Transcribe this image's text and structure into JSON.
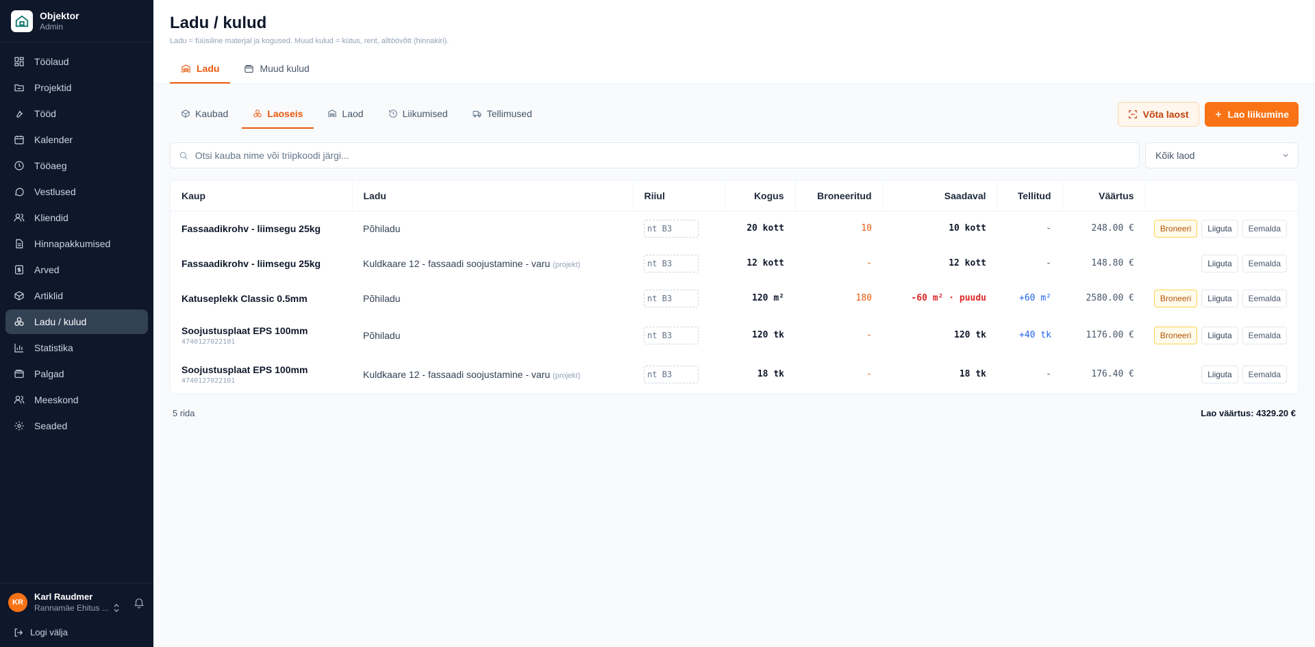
{
  "app": {
    "name": "Objektor",
    "role": "Admin"
  },
  "sidebar": {
    "items": [
      {
        "label": "Töölaud",
        "icon": "dashboard-icon"
      },
      {
        "label": "Projektid",
        "icon": "folder-icon"
      },
      {
        "label": "Tööd",
        "icon": "wrench-icon"
      },
      {
        "label": "Kalender",
        "icon": "calendar-icon"
      },
      {
        "label": "Tööaeg",
        "icon": "clock-icon"
      },
      {
        "label": "Vestlused",
        "icon": "chat-icon"
      },
      {
        "label": "Kliendid",
        "icon": "users-icon"
      },
      {
        "label": "Hinnapakkumised",
        "icon": "document-icon"
      },
      {
        "label": "Arved",
        "icon": "invoice-icon"
      },
      {
        "label": "Artiklid",
        "icon": "package-icon"
      },
      {
        "label": "Ladu / kulud",
        "icon": "boxes-icon",
        "active": true
      },
      {
        "label": "Statistika",
        "icon": "chart-icon"
      },
      {
        "label": "Palgad",
        "icon": "wallet-icon"
      },
      {
        "label": "Meeskond",
        "icon": "team-icon"
      },
      {
        "label": "Seaded",
        "icon": "gear-icon"
      }
    ]
  },
  "user": {
    "initials": "KR",
    "name": "Karl Raudmer",
    "company": "Rannamäe Ehitus ...",
    "logout": "Logi välja"
  },
  "header": {
    "title": "Ladu / kulud",
    "subtitle": "Ladu = füüsiline materjal ja kogused. Muud kulud = kütus, rent, alltöövõtt (hinnakiri).",
    "tabs": [
      {
        "label": "Ladu",
        "active": true
      },
      {
        "label": "Muud kulud",
        "active": false
      }
    ]
  },
  "subtabs": [
    {
      "label": "Kaubad",
      "icon": "box-icon"
    },
    {
      "label": "Laoseis",
      "icon": "stack-icon",
      "active": true
    },
    {
      "label": "Laod",
      "icon": "warehouse-icon"
    },
    {
      "label": "Liikumised",
      "icon": "history-icon"
    },
    {
      "label": "Tellimused",
      "icon": "truck-icon"
    }
  ],
  "actions": {
    "take_from_stock": "Võta laost",
    "stock_movement": "Lao liikumine"
  },
  "search": {
    "placeholder": "Otsi kauba nime või triipkoodi järgi..."
  },
  "warehouse_filter": {
    "selected": "Kõik laod"
  },
  "table": {
    "columns": [
      "Kaup",
      "Ladu",
      "Riiul",
      "Kogus",
      "Broneeritud",
      "Saadaval",
      "Tellitud",
      "Väärtus",
      ""
    ],
    "shelf_placeholder": "nt B3",
    "project_tag": "(projekt)",
    "rows": [
      {
        "item": "Fassaadikrohv - liimsegu 25kg",
        "code": "",
        "warehouse": "Põhiladu",
        "is_project": false,
        "quantity": "20 kott",
        "reserved": "10",
        "available": "10 kott",
        "available_short": false,
        "ordered": "-",
        "value": "248.00 €",
        "can_book": true
      },
      {
        "item": "Fassaadikrohv - liimsegu 25kg",
        "code": "",
        "warehouse": "Kuldkaare 12 - fassaadi soojustamine - varu",
        "is_project": true,
        "quantity": "12 kott",
        "reserved": "-",
        "available": "12 kott",
        "available_short": false,
        "ordered": "-",
        "value": "148.80 €",
        "can_book": false
      },
      {
        "item": "Katuseplekk Classic 0.5mm",
        "code": "",
        "warehouse": "Põhiladu",
        "is_project": false,
        "quantity": "120 m²",
        "reserved": "180",
        "available": "-60 m² · puudu",
        "available_short": true,
        "ordered": "+60 m²",
        "value": "2580.00 €",
        "can_book": true
      },
      {
        "item": "Soojustusplaat EPS 100mm",
        "code": "4740127022101",
        "warehouse": "Põhiladu",
        "is_project": false,
        "quantity": "120 tk",
        "reserved": "-",
        "available": "120 tk",
        "available_short": false,
        "ordered": "+40 tk",
        "value": "1176.00 €",
        "can_book": true
      },
      {
        "item": "Soojustusplaat EPS 100mm",
        "code": "4740127022101",
        "warehouse": "Kuldkaare 12 - fassaadi soojustamine - varu",
        "is_project": true,
        "quantity": "18 tk",
        "reserved": "-",
        "available": "18 tk",
        "available_short": false,
        "ordered": "-",
        "value": "176.40 €",
        "can_book": false
      }
    ],
    "row_buttons": {
      "book": "Broneeri",
      "move": "Liiguta",
      "remove": "Eemalda"
    }
  },
  "footer": {
    "row_count": "5 rida",
    "total_value": "Lao väärtus: 4329.20 €"
  },
  "colors": {
    "accent": "#f97316",
    "sidebar_bg": "#0f172a",
    "shortage": "#dc2626",
    "ordered": "#2563eb",
    "reserved": "#ea580c"
  }
}
